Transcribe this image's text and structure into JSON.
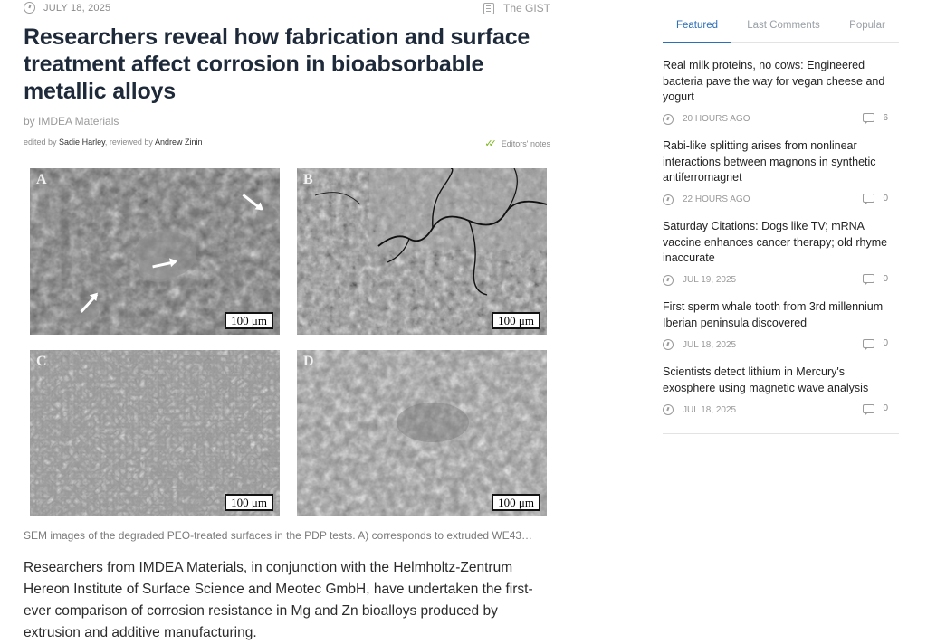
{
  "article": {
    "date": "JULY 18, 2025",
    "gist_label": "The GIST",
    "title": "Researchers reveal how fabrication and surface treatment affect corrosion in bioabsorbable metallic alloys",
    "byline": "by IMDEA Materials",
    "edited_prefix": "edited by",
    "editor": "Sadie Harley",
    "reviewed_prefix": ", reviewed by",
    "reviewer": "Andrew Zinin",
    "editors_notes": "Editors' notes",
    "figure": {
      "panels": [
        {
          "letter": "A",
          "scale": "100 μm"
        },
        {
          "letter": "B",
          "scale": "100 μm"
        },
        {
          "letter": "C",
          "scale": "100 μm"
        },
        {
          "letter": "D",
          "scale": "100 μm"
        }
      ]
    },
    "caption": "SEM images of the degraded PEO-treated surfaces in the PDP tests. A) corresponds to extruded WE43…",
    "lead": "Researchers from IMDEA Materials, in conjunction with the Helmholtz-Zentrum Hereon Institute of Surface Science and Meotec GmbH, have undertaken the first-ever comparison of corrosion resistance in Mg and Zn bioalloys produced by extrusion and additive manufacturing."
  },
  "sidebar": {
    "tabs": [
      {
        "label": "Featured",
        "active": true
      },
      {
        "label": "Last Comments",
        "active": false
      },
      {
        "label": "Popular",
        "active": false
      }
    ],
    "news": [
      {
        "title": "Real milk proteins, no cows: Engineered bacteria pave the way for vegan cheese and yogurt",
        "time": "20 HOURS AGO",
        "comments": "6"
      },
      {
        "title": "Rabi-like splitting arises from nonlinear interactions between magnons in synthetic antiferromagnet",
        "time": "22 HOURS AGO",
        "comments": "0"
      },
      {
        "title": "Saturday Citations: Dogs like TV; mRNA vaccine enhances cancer therapy; old rhyme inaccurate",
        "time": "JUL 19, 2025",
        "comments": "0"
      },
      {
        "title": "First sperm whale tooth from 3rd millennium Iberian peninsula discovered",
        "time": "JUL 18, 2025",
        "comments": "0"
      },
      {
        "title": "Scientists detect lithium in Mercury's exosphere using magnetic wave analysis",
        "time": "JUL 18, 2025",
        "comments": "0"
      }
    ]
  },
  "colors": {
    "accent": "#2c6eb8",
    "title": "#1e2a3a",
    "check": "#7cb518"
  },
  "icons": [
    "clock-icon",
    "gist-icon",
    "check-icon",
    "comment-icon"
  ]
}
